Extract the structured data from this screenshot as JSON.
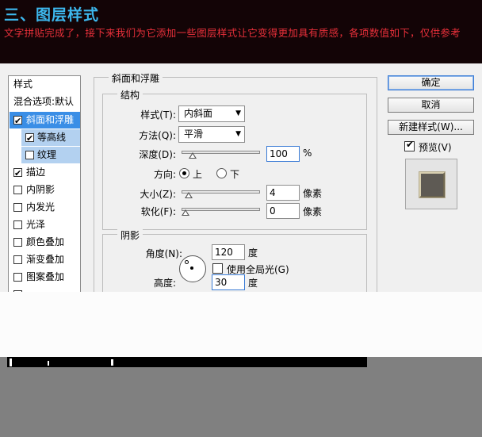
{
  "banner": {
    "title": "三、图层样式",
    "description": "文字拼贴完成了，接下来我们为它添加一些图层样式让它变得更加具有质感，各项数值如下，仅供参考"
  },
  "style_list": {
    "header": "样式",
    "blend_options": "混合选项:默认",
    "items": [
      {
        "label": "斜面和浮雕",
        "checked": true,
        "selected": true
      },
      {
        "label": "等高线",
        "checked": true,
        "sub": true
      },
      {
        "label": "纹理",
        "checked": false,
        "sub": true
      },
      {
        "label": "描边",
        "checked": true
      },
      {
        "label": "内阴影",
        "checked": false
      },
      {
        "label": "内发光",
        "checked": false
      },
      {
        "label": "光泽",
        "checked": false
      },
      {
        "label": "颜色叠加",
        "checked": false
      },
      {
        "label": "渐变叠加",
        "checked": false
      },
      {
        "label": "图案叠加",
        "checked": false
      }
    ]
  },
  "bevel": {
    "group_title": "斜面和浮雕",
    "structure_title": "结构",
    "style_label": "样式(T):",
    "style_value": "内斜面",
    "technique_label": "方法(Q):",
    "technique_value": "平滑",
    "depth_label": "深度(D):",
    "depth_value": "100",
    "depth_unit": "%",
    "depth_slider": 0.1,
    "direction_label": "方向:",
    "direction_up": "上",
    "direction_down": "下",
    "size_label": "大小(Z):",
    "size_value": "4",
    "size_unit": "像素",
    "size_slider": 0.04,
    "soften_label": "软化(F):",
    "soften_value": "0",
    "soften_unit": "像素",
    "soften_slider": 0.0
  },
  "shading": {
    "title": "阴影",
    "angle_label": "角度(N):",
    "angle_value": "120",
    "angle_unit": "度",
    "global_light_label": "使用全局光(G)",
    "altitude_label": "高度:",
    "altitude_value": "30",
    "altitude_unit": "度"
  },
  "buttons": {
    "ok": "确定",
    "cancel": "取消",
    "new_style": "新建样式(W)...",
    "preview": "预览(V)"
  },
  "colors": {
    "banner_bg": "#130406",
    "title_color": "#3db8ee",
    "desc_color": "#e8303a",
    "selection": "#3a8ee6",
    "sub_selection": "#b3d1f0"
  }
}
